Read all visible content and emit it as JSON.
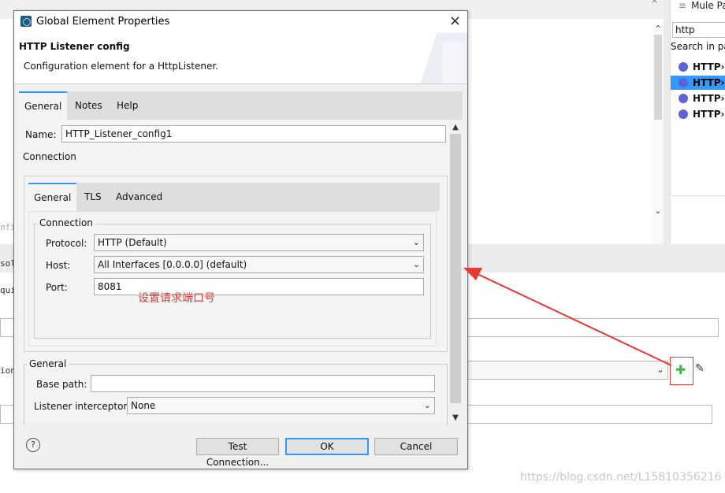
{
  "background": {
    "palette_title": "Mule Pa",
    "palette_search": "http",
    "palette_search_in": "Search in pal",
    "palette_items": [
      "HTTP›",
      "HTTP›",
      "HTTP›",
      "HTTP›"
    ],
    "left_fragments": [
      "nfigu",
      "sole",
      "quir",
      "ion:"
    ],
    "watermark": "https://blog.csdn.net/L15810356216",
    "corner_label": "×"
  },
  "dialog": {
    "window_title": "Global Element Properties",
    "close_icon": "×",
    "header_title": "HTTP Listener config",
    "header_desc": "Configuration element for a HttpListener.",
    "tabs": [
      "General",
      "Notes",
      "Help"
    ],
    "name_label": "Name:",
    "name_value": "HTTP_Listener_config1",
    "connection_section": "Connection",
    "inner_tabs": [
      "General",
      "TLS",
      "Advanced"
    ],
    "connection_group": "Connection",
    "protocol_label": "Protocol:",
    "protocol_value": "HTTP (Default)",
    "host_label": "Host:",
    "host_value": "All Interfaces [0.0.0.0] (default)",
    "port_label": "Port:",
    "port_value": "8081",
    "general_group": "General",
    "base_path_label": "Base path:",
    "base_path_value": "",
    "interceptors_label": "Listener interceptors",
    "interceptors_value": "None",
    "help_icon": "?",
    "buttons": {
      "test": "Test Connection...",
      "ok": "OK",
      "cancel": "Cancel"
    }
  },
  "annotation": "设置请求端口号",
  "colors": {
    "accent": "#3399ff",
    "annotation": "#e53935",
    "add_icon": "#4caf50"
  }
}
